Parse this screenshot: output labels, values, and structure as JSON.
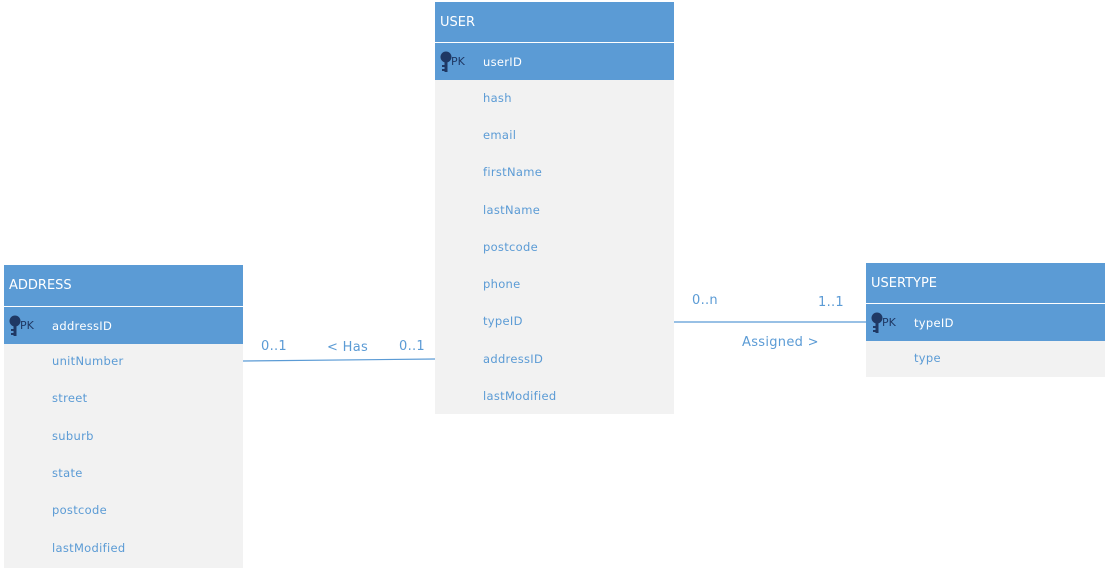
{
  "entities": {
    "user": {
      "title": "USER",
      "pk_label": "PK",
      "pk_field": "userID",
      "fields": [
        "hash",
        "email",
        "firstName",
        "lastName",
        "postcode",
        "phone",
        "typeID",
        "addressID",
        "lastModified"
      ]
    },
    "address": {
      "title": "ADDRESS",
      "pk_label": "PK",
      "pk_field": "addressID",
      "fields": [
        "unitNumber",
        "street",
        "suburb",
        "state",
        "postcode",
        "lastModified"
      ]
    },
    "usertype": {
      "title": "USERTYPE",
      "pk_label": "PK",
      "pk_field": "typeID",
      "fields": [
        "type"
      ]
    }
  },
  "relationships": {
    "has": {
      "label": "< Has",
      "address_card": "0..1",
      "user_card": "0..1"
    },
    "assigned": {
      "label": "Assigned >",
      "user_card": "0..n",
      "usertype_card": "1..1"
    }
  },
  "colors": {
    "header": "#5b9bd5",
    "body": "#f2f2f2",
    "field_text": "#5b9bd5",
    "pk_text": "#1f3864",
    "line": "#5b9bd5"
  }
}
